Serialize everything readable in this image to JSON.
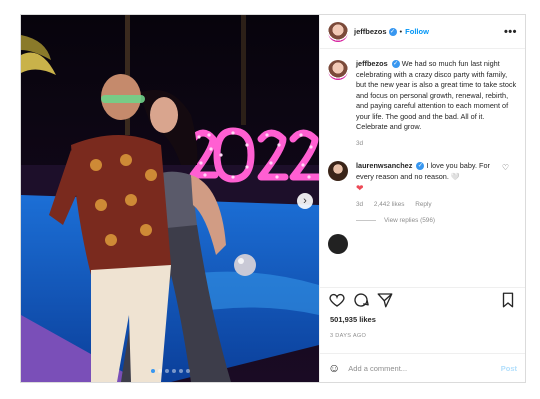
{
  "post": {
    "username": "jeffbezos",
    "follow_label": "Follow",
    "more_label": "•••",
    "caption": "We had so much fun last night celebrating with a crazy disco party with family, but the new year is also a great time to take stock and focus on personal growth, renewal, rebirth, and paying careful attention to each moment of your life. The good and the bad. All of it. Celebrate and grow.",
    "caption_age": "3d",
    "image_sign_text": "2022",
    "carousel": {
      "count": 6,
      "active_index": 0
    }
  },
  "comments": [
    {
      "username": "laurenwsanchez",
      "text": "I love you baby. For every reason and no reason. 🤍",
      "extra_emoji": "❤",
      "age": "3d",
      "likes": "2,442 likes",
      "reply_label": "Reply",
      "view_replies": "View replies (596)"
    }
  ],
  "actions": {
    "likes": "501,935 likes",
    "date": "3 DAYS AGO"
  },
  "add_comment": {
    "placeholder": "Add a comment...",
    "post_label": "Post"
  },
  "colors": {
    "accent": "#0095f6",
    "verified": "#3897f0",
    "heart": "#ed4956"
  },
  "icons": [
    "more-icon",
    "verified-icon",
    "heart-icon",
    "comment-icon",
    "share-icon",
    "bookmark-icon",
    "emoji-icon",
    "chevron-right-icon"
  ]
}
